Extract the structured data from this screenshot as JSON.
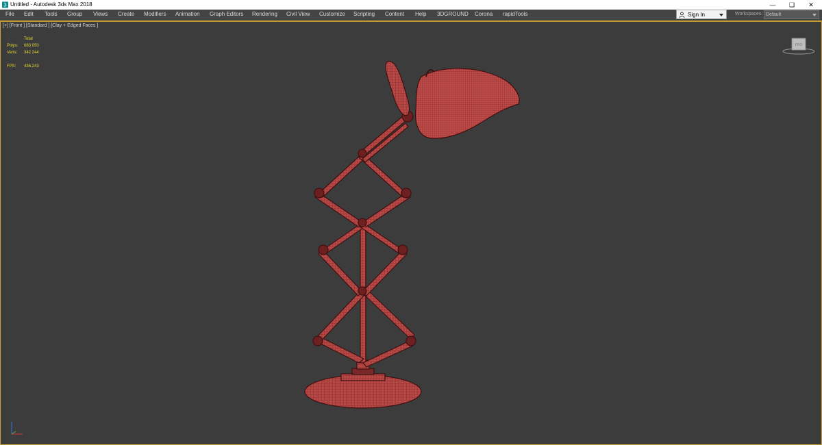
{
  "window": {
    "title": "Untitled - Autodesk 3ds Max 2018",
    "icon": "3ds-max-app-icon",
    "controls": [
      "minimize-icon",
      "restore-icon",
      "close-icon"
    ]
  },
  "menu": {
    "items": [
      "File",
      "Edit",
      "Tools",
      "Group",
      "Views",
      "Create",
      "Modifiers",
      "Animation",
      "Graph Editors",
      "Rendering",
      "Civil View",
      "Customize",
      "Scripting",
      "Content",
      "Help",
      "3DGROUND",
      "Corona",
      "rapidTools"
    ]
  },
  "account": {
    "signin_label": "Sign In",
    "icon": "person-icon"
  },
  "workspace": {
    "label": "Workspaces:",
    "value": "Default"
  },
  "viewport": {
    "label": "[+] [Front ] [Standard ] [Clay + Edged Faces ]",
    "stats": {
      "header": "Total",
      "polys_label": "Polys:",
      "polys_value": "683 050",
      "verts_label": "Verts:",
      "verts_value": "342 244",
      "fps_label": "FPS:",
      "fps_value": "436,243"
    },
    "viewcube_label": "FRO"
  },
  "colors": {
    "accent": "#cda33a",
    "stats_text": "#e3d832",
    "viewport_bg": "#3c3c3c",
    "model_fill": "#b84846",
    "model_wire": "#4a1414"
  }
}
